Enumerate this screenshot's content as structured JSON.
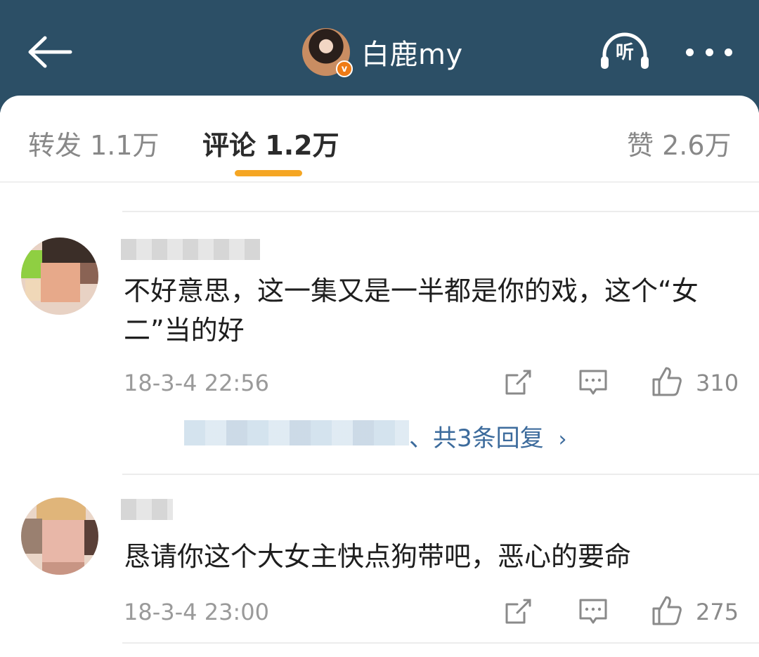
{
  "header": {
    "username": "白鹿my",
    "verified_badge": "v",
    "listen_label": "听",
    "icons": {
      "back": "back-arrow-icon",
      "listen": "headphones-icon",
      "more": "more-dots-icon"
    },
    "colors": {
      "bar": "#2c4f66",
      "badge": "#ef7b16"
    }
  },
  "tabs": [
    {
      "label": "转发",
      "count": "1.1万"
    },
    {
      "label": "评论",
      "count": "1.2万"
    },
    {
      "label": "赞",
      "count": "2.6万"
    }
  ],
  "active_tab": "评论",
  "comments": [
    {
      "username": "",
      "text": "不好意思，这一集又是一半都是你的戏，这个“女二”当的好",
      "time": "18-3-4 22:56",
      "likes": "310",
      "replies_summary": "、共3条回复"
    },
    {
      "username": "",
      "text": "恳请你这个大女主快点狗带吧，恶心的要命",
      "time": "18-3-4 23:00",
      "likes": "275"
    }
  ],
  "accent_color": "#f5a623",
  "link_color": "#3c6b9c"
}
